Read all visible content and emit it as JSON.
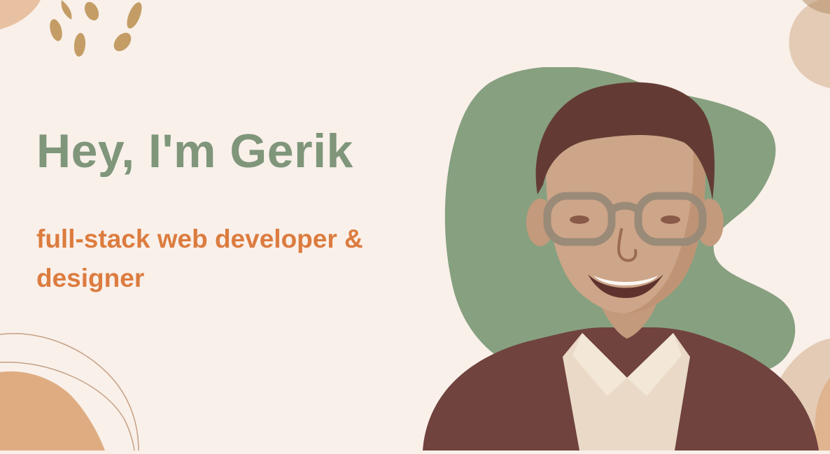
{
  "hero": {
    "headline": "Hey, I'm Gerik",
    "tagline": "full-stack web developer & designer"
  },
  "portrait": {
    "alt": "Portrait of Gerik smiling, wearing glasses"
  },
  "colors": {
    "background": "#f9f0ea",
    "headline": "#7f967a",
    "tagline": "#dc7c3f",
    "blob_green": "#87a080",
    "leaf_tan": "#c49d66",
    "shape_peach": "#dfac82",
    "shape_beige": "#e3cbb5",
    "line_brown": "#c7a184"
  },
  "icons": [
    "leaf-cluster-icon"
  ]
}
